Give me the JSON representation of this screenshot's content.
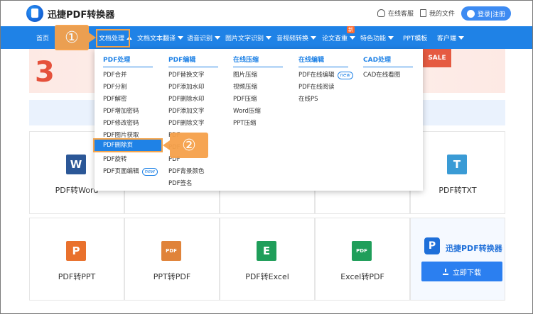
{
  "header": {
    "brand": "迅捷PDF转换器",
    "support": "在线客服",
    "my_files": "我的文件",
    "login": "登录|注册"
  },
  "nav": {
    "items": [
      {
        "label": "首页",
        "caret": false
      },
      {
        "label": "文档处理",
        "caret": true,
        "active": true
      },
      {
        "label": "文档文本翻译",
        "caret": true
      },
      {
        "label": "语音识别",
        "caret": true
      },
      {
        "label": "图片文字识别",
        "caret": true
      },
      {
        "label": "音视频转换",
        "caret": true
      },
      {
        "label": "论文查重",
        "caret": true,
        "badge": "新"
      },
      {
        "label": "特色功能",
        "caret": true
      },
      {
        "label": "PPT模板",
        "caret": false
      },
      {
        "label": "客户端",
        "caret": true
      }
    ]
  },
  "dropdown": {
    "columns": [
      {
        "title": "PDF处理",
        "items": [
          "PDF合并",
          "PDF分割",
          "PDF解密",
          "PDF增加密码",
          "PDF修改密码",
          "PDF图片获取",
          "PDF删除页",
          "PDF旋转",
          "PDF页面编辑"
        ]
      },
      {
        "title": "PDF编辑",
        "items": [
          "PDF替换文字",
          "PDF添加水印",
          "PDF删除水印",
          "PDF添加文字",
          "PDF删除文字",
          "PDF",
          "PDF",
          "PDF",
          "PDF背景颜色",
          "PDF签名"
        ]
      },
      {
        "title": "在线压缩",
        "items": [
          "图片压缩",
          "视频压缩",
          "PDF压缩",
          "Word压缩",
          "PPT压缩"
        ]
      },
      {
        "title": "在线编辑",
        "items": [
          "PDF在线编辑",
          "PDF在线阅读",
          "在线PS"
        ]
      },
      {
        "title": "CAD处理",
        "items": [
          "CAD在线看图"
        ]
      }
    ],
    "new_tag": "new",
    "highlighted": "PDF删除页"
  },
  "banner": {
    "big_text": "3",
    "sale": "SALE"
  },
  "tools": [
    {
      "label": "PDF转Word",
      "icon": "W",
      "color": "#2b5797"
    },
    {
      "label": "PDF转TXT",
      "icon": "T",
      "color": "#3a9bd5"
    },
    {
      "label": "PDF转PPT",
      "icon": "P",
      "color": "#e9712d"
    },
    {
      "label": "PPT转PDF",
      "icon": "PDF",
      "color": "#e0833a"
    },
    {
      "label": "PDF转Excel",
      "icon": "E",
      "color": "#1f9e5a"
    },
    {
      "label": "Excel转PDF",
      "icon": "PDF",
      "color": "#1f9e5a"
    }
  ],
  "download": {
    "brand": "迅捷PDF转换器",
    "button": "立即下载"
  },
  "callouts": {
    "step1": "①",
    "step2": "②"
  }
}
